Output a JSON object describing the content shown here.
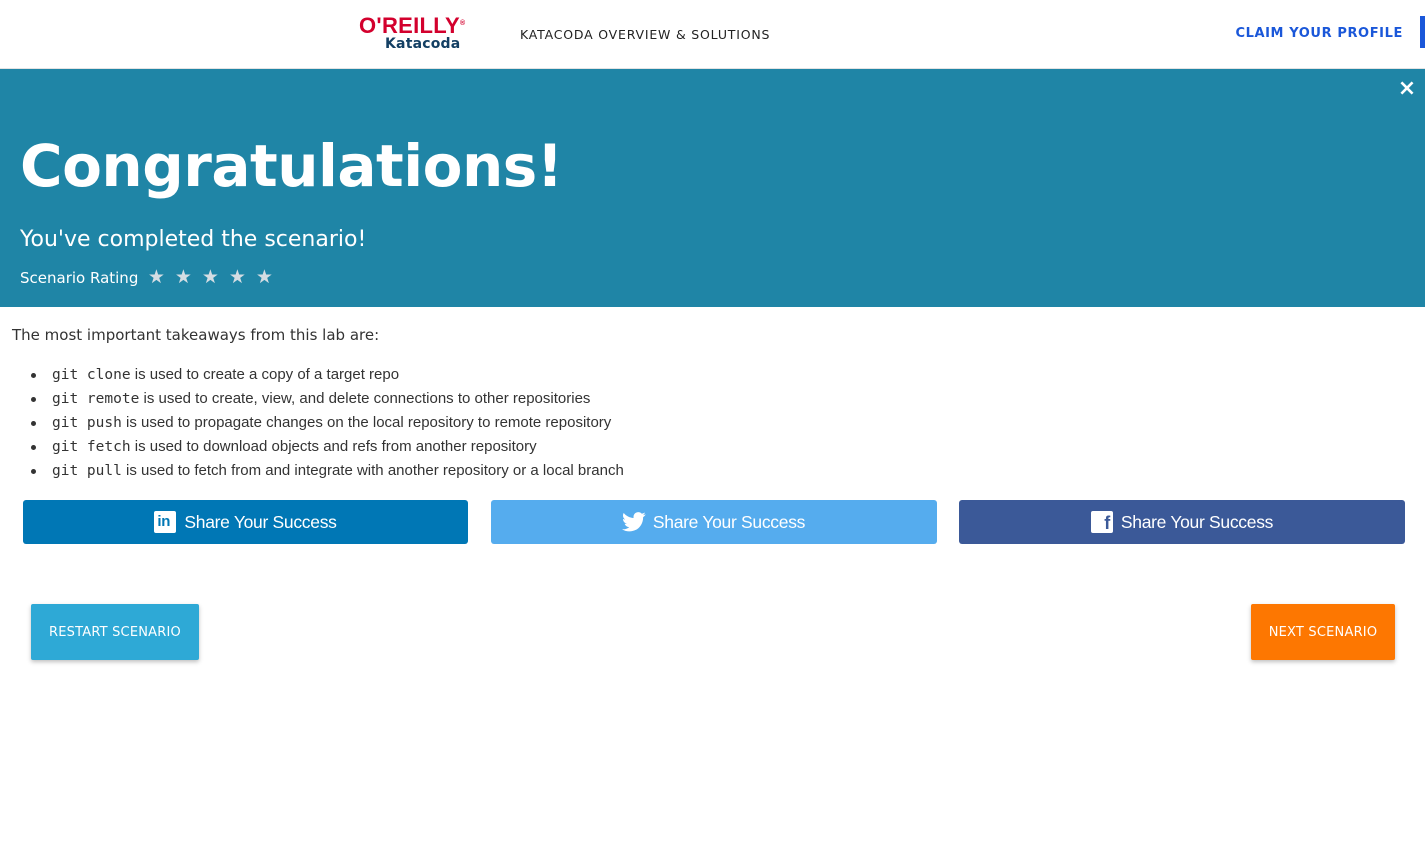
{
  "header": {
    "logo_brand": "O'REILLY",
    "logo_product": "Katacoda",
    "nav_link": "KATACODA OVERVIEW & SOLUTIONS",
    "claim_profile": "CLAIM YOUR PROFILE"
  },
  "hero": {
    "close_glyph": "×",
    "title": "Congratulations!",
    "subtitle": "You've completed the scenario!",
    "rating_label": "Scenario Rating",
    "rating_max": 5,
    "rating_value": 0,
    "star_glyph": "★"
  },
  "content": {
    "intro": "The most important takeaways from this lab are:",
    "takeaways": [
      {
        "command": "git clone",
        "text": " is used to create a copy of a target repo"
      },
      {
        "command": "git remote",
        "text": " is used to create, view, and delete connections to other repositories"
      },
      {
        "command": "git push",
        "text": " is used to propagate changes on the local repository to remote repository"
      },
      {
        "command": "git fetch",
        "text": " is used to download objects and refs from another repository"
      },
      {
        "command": "git pull",
        "text": " is used to fetch from and integrate with another repository or a local branch"
      }
    ]
  },
  "share": {
    "linkedin_label": "Share Your Success",
    "twitter_label": "Share Your Success",
    "facebook_label": "Share Your Success",
    "linkedin_color": "#0077b5",
    "twitter_color": "#55acee",
    "facebook_color": "#3b5998"
  },
  "actions": {
    "restart_label": "RESTART SCENARIO",
    "next_label": "NEXT SCENARIO",
    "restart_color": "#2ea9d6",
    "next_color": "#fd7701"
  },
  "colors": {
    "hero_bg": "#1f85a6",
    "brand_red": "#d3002d",
    "link_blue": "#1a57d9"
  }
}
